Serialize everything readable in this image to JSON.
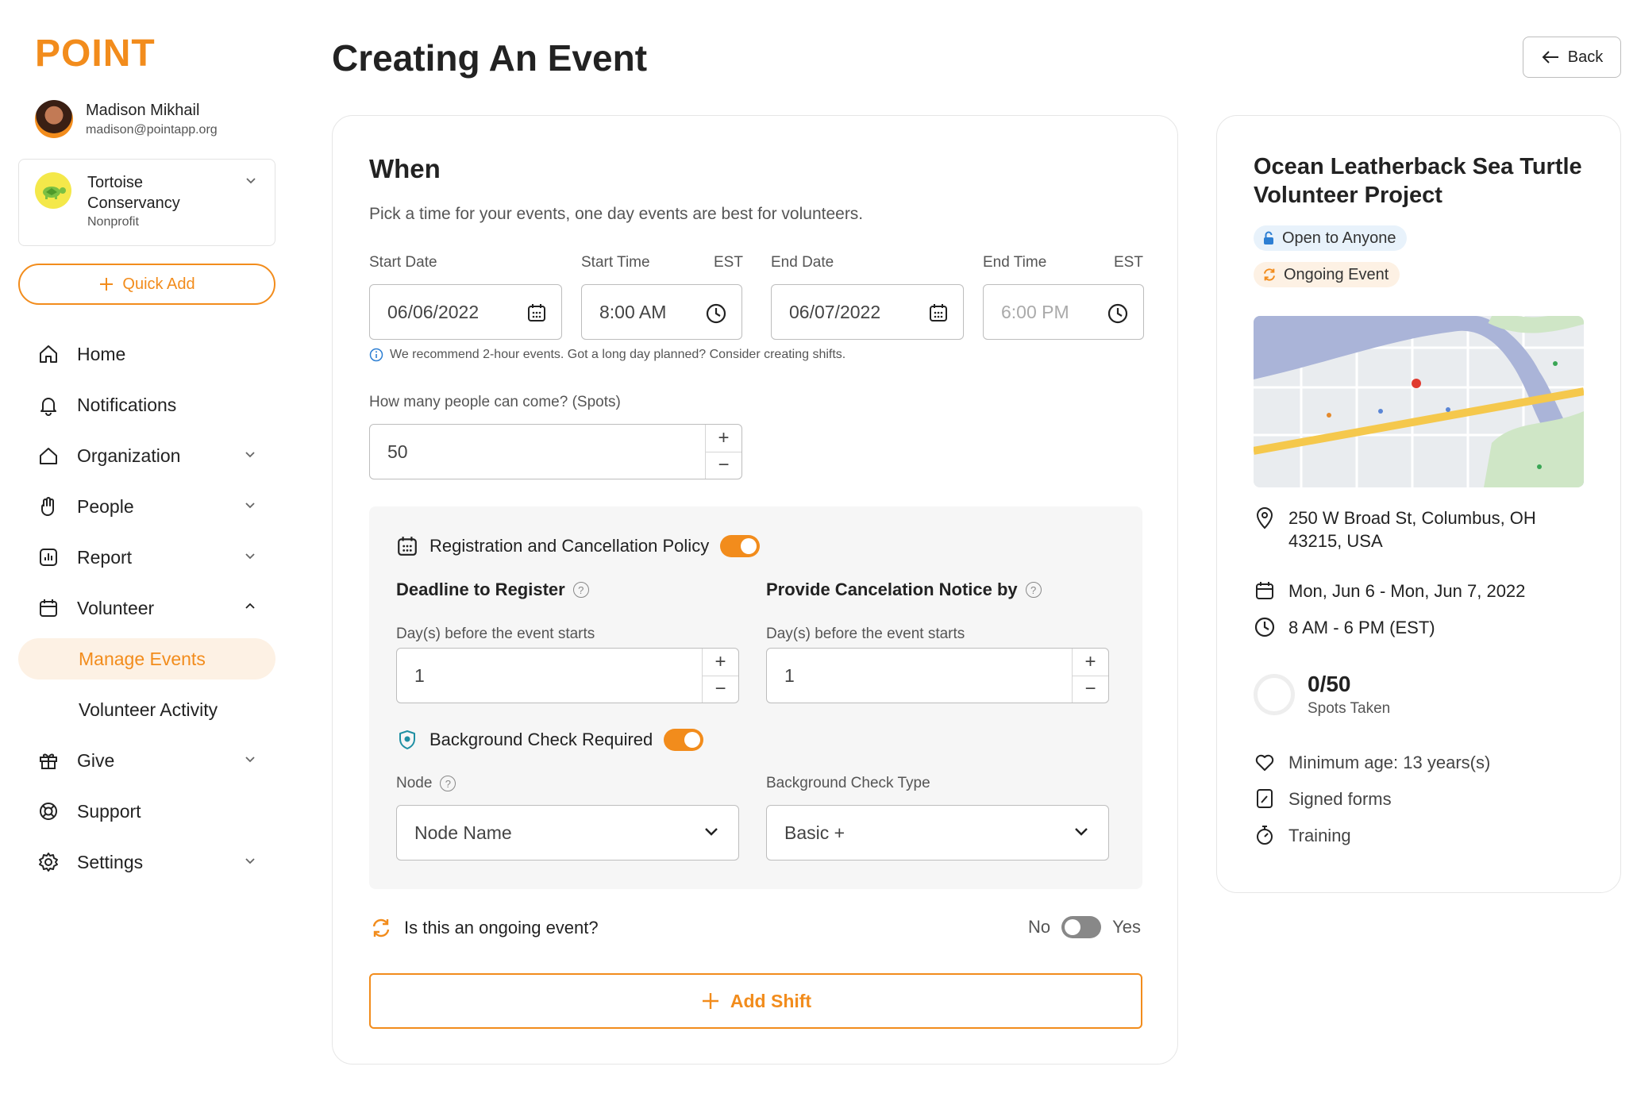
{
  "brand": {
    "logo": "POINT",
    "accent": "#f28c1c"
  },
  "user": {
    "name": "Madison Mikhail",
    "email": "madison@pointapp.org"
  },
  "org": {
    "name": "Tortoise Conservancy",
    "type": "Nonprofit"
  },
  "sidebar": {
    "quick_add": "Quick Add",
    "items": [
      {
        "label": "Home"
      },
      {
        "label": "Notifications"
      },
      {
        "label": "Organization"
      },
      {
        "label": "People"
      },
      {
        "label": "Report"
      },
      {
        "label": "Volunteer"
      },
      {
        "label": "Manage Events"
      },
      {
        "label": "Volunteer Activity"
      },
      {
        "label": "Give"
      },
      {
        "label": "Support"
      },
      {
        "label": "Settings"
      }
    ]
  },
  "header": {
    "title": "Creating An Event",
    "back": "Back"
  },
  "form": {
    "section_title": "When",
    "section_desc": "Pick a time for your events, one day events are best for volunteers.",
    "start_date_label": "Start Date",
    "start_date": "06/06/2022",
    "start_time_label": "Start Time",
    "start_time": "8:00 AM",
    "end_date_label": "End Date",
    "end_date": "06/07/2022",
    "end_time_label": "End Time",
    "end_time_placeholder": "6:00 PM",
    "tz": "EST",
    "hint": "We recommend 2-hour events. Got a long day planned? Consider creating shifts.",
    "spots_label": "How many people can come? (Spots)",
    "spots": "50",
    "policy_label": "Registration and Cancellation Policy",
    "deadline_label": "Deadline to Register",
    "cancel_label": "Provide Cancelation Notice by",
    "days_before": "Day(s) before the event starts",
    "deadline_value": "1",
    "cancel_value": "1",
    "bg_check_label": "Background Check Required",
    "node_label": "Node",
    "node_value": "Node Name",
    "bg_type_label": "Background Check Type",
    "bg_type_value": "Basic +",
    "ongoing_label": "Is this an ongoing event?",
    "no": "No",
    "yes": "Yes",
    "add_shift": "Add Shift"
  },
  "summary": {
    "title": "Ocean Leatherback Sea Turtle Volunteer Project",
    "open_pill": "Open to Anyone",
    "ongoing_pill": "Ongoing Event",
    "address": "250 W Broad St, Columbus, OH 43215, USA",
    "dates": "Mon, Jun 6 - Mon, Jun 7, 2022",
    "time": "8 AM - 6 PM (EST)",
    "spots": "0/50",
    "spots_label": "Spots Taken",
    "min_age": "Minimum age: 13 years(s)",
    "forms": "Signed forms",
    "training": "Training"
  }
}
